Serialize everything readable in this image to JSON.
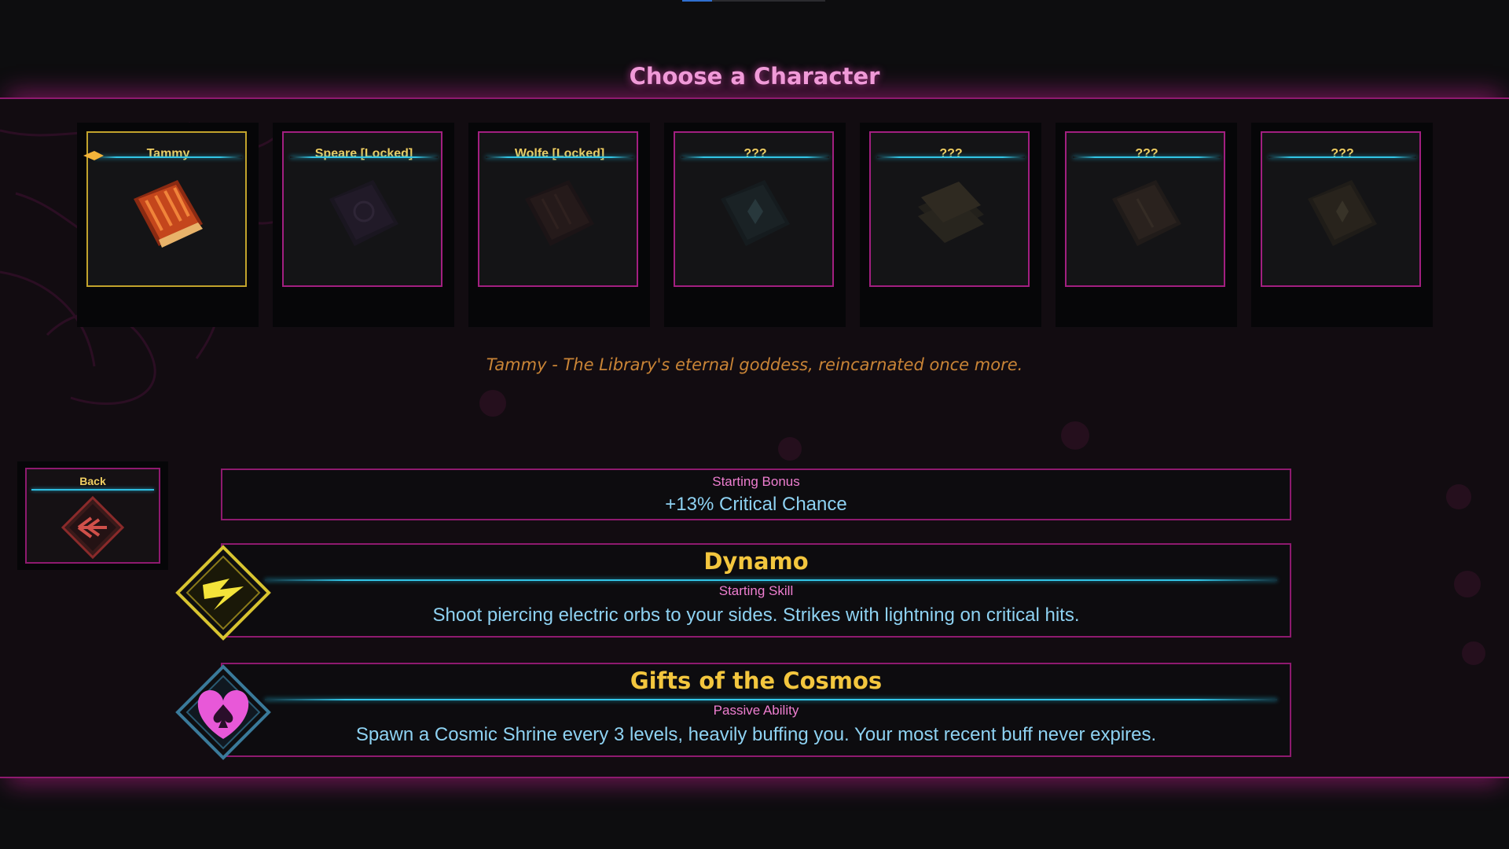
{
  "title": "Choose a Character",
  "colors": {
    "accent_pink": "#a21f80",
    "selected_gold": "#c2a32c",
    "gold_text": "#f1cf62",
    "cyan_line": "#32c5e6",
    "desc_orange": "#c98436",
    "body_blue": "#8ed2f2"
  },
  "characters": [
    {
      "name": "Tammy",
      "locked": false,
      "selected": true,
      "icon": "red-book-icon"
    },
    {
      "name": "Speare [Locked]",
      "locked": true,
      "selected": false,
      "icon": "dark-purple-book-icon"
    },
    {
      "name": "Wolfe [Locked]",
      "locked": true,
      "selected": false,
      "icon": "dark-red-book-icon"
    },
    {
      "name": "???",
      "locked": true,
      "selected": false,
      "icon": "teal-book-icon"
    },
    {
      "name": "???",
      "locked": true,
      "selected": false,
      "icon": "stacked-books-icon"
    },
    {
      "name": "???",
      "locked": true,
      "selected": false,
      "icon": "brown-book-icon"
    },
    {
      "name": "???",
      "locked": true,
      "selected": false,
      "icon": "gold-book-icon"
    }
  ],
  "description": "Tammy - The Library's eternal goddess, reincarnated once more.",
  "back": {
    "label": "Back",
    "icon": "back-arrow-icon"
  },
  "starting_bonus": {
    "label": "Starting Bonus",
    "value": "+13% Critical Chance"
  },
  "skills": [
    {
      "name": "Dynamo",
      "type": "Starting Skill",
      "description": "Shoot piercing electric orbs to your sides. Strikes with lightning on critical hits.",
      "icon": "lightning-icon"
    },
    {
      "name": "Gifts of the Cosmos",
      "type": "Passive Ability",
      "description": "Spawn a Cosmic Shrine every 3 levels, heavily buffing you. Your most recent buff never expires.",
      "icon": "heart-spade-icon"
    }
  ]
}
